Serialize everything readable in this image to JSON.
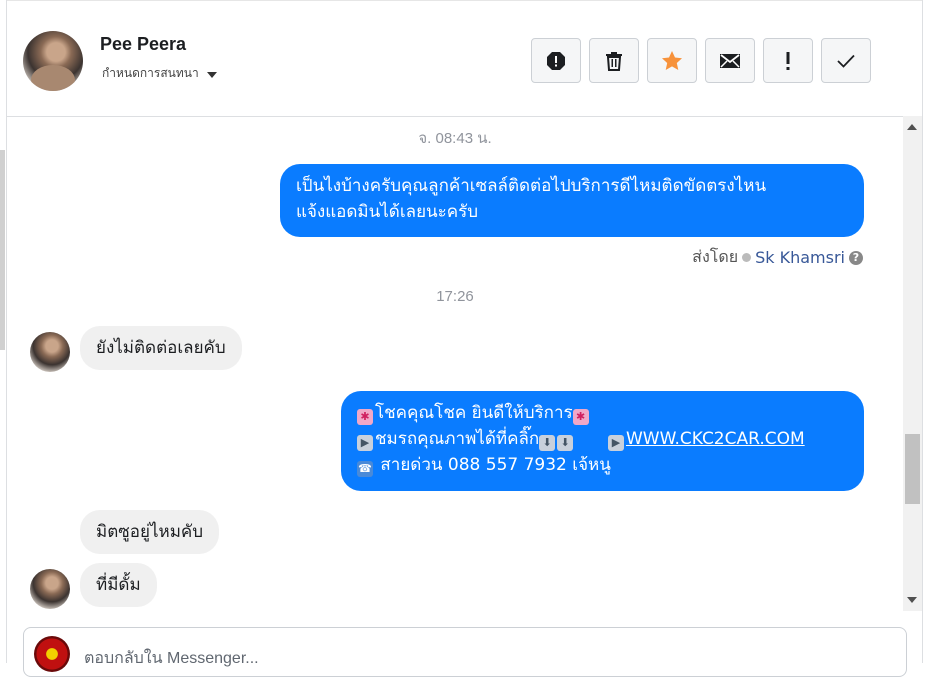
{
  "header": {
    "name": "Pee Peera",
    "assign_label": "กำหนดการสนทนา",
    "actions": [
      {
        "icon": "spam-report-icon"
      },
      {
        "icon": "trash-icon"
      },
      {
        "icon": "star-icon"
      },
      {
        "icon": "envelope-icon"
      },
      {
        "icon": "exclamation-icon"
      },
      {
        "icon": "checkmark-icon"
      }
    ],
    "accent_star_color": "#f7923b"
  },
  "chat": {
    "timestamp1": "จ. 08:43 น.",
    "msg1": {
      "line1": "เป็นไงบ้างครับคุณลูกค้าเซลล์ติดต่อไปบริการดีไหมติดขัดตรงไหน",
      "line2": "แจ้งแอดมินได้เลยนะครับ"
    },
    "sent_by_label": "ส่งโดย",
    "sent_by_agent": "Sk Khamsri",
    "timestamp2": "17:26",
    "msg2": "ยังไม่ติดต่อเลยคับ",
    "msg3": {
      "line1": "โชคคุณโชค ยินดีให้บริการ",
      "line2": "ชมรถคุณภาพได้ที่คลิ๊ก",
      "link": "WWW.CKC2CAR.COM",
      "line3": "สายด่วน 088 557 7932 เจ้หนู"
    },
    "msg4": "มิตซูอยู่ไหมคับ",
    "msg5": "ที่มีดั้ม"
  },
  "composer": {
    "placeholder": "ตอบกลับใน Messenger..."
  },
  "colors": {
    "outgoing_bubble": "#0a7cff",
    "incoming_bubble": "#f0f0f0"
  }
}
